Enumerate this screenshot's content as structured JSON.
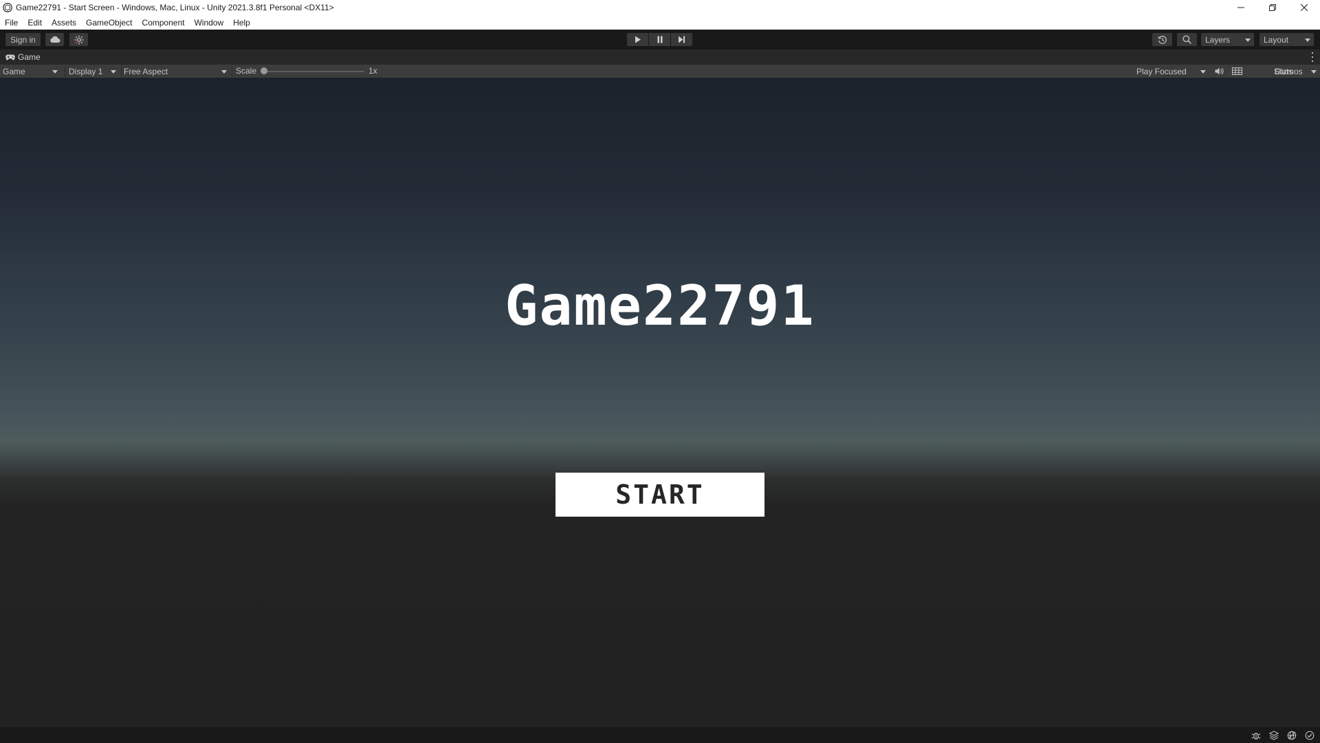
{
  "window": {
    "title": "Game22791 - Start Screen - Windows, Mac, Linux - Unity 2021.3.8f1 Personal <DX11>",
    "controls": [
      "minimize-icon",
      "restore-icon",
      "close-icon"
    ]
  },
  "menubar": {
    "items": [
      "File",
      "Edit",
      "Assets",
      "GameObject",
      "Component",
      "Window",
      "Help"
    ]
  },
  "toolbar": {
    "sign_in": "Sign in",
    "cloud_icon": "cloud-icon",
    "collab_icon": "services-icon",
    "play_icon": "play-icon",
    "pause_icon": "pause-icon",
    "step_icon": "step-icon",
    "history_icon": "history-icon",
    "search_icon": "search-icon",
    "layers": "Layers",
    "layout": "Layout"
  },
  "game_tab": {
    "label": "Game",
    "icon": "gamepad-icon"
  },
  "game_view": {
    "mode": "Game",
    "display": "Display 1",
    "aspect": "Free Aspect",
    "scale_label": "Scale",
    "scale_value": "1x",
    "play_mode": "Play Focused",
    "audio_icon": "speaker-icon",
    "stats_grid_icon": "grid-icon",
    "stats": "Stats",
    "gizmos": "Gizmos"
  },
  "game": {
    "title": "Game22791",
    "start_button": "START"
  },
  "statusbar": {
    "icons": [
      "debug-icon",
      "layers-status-icon",
      "network-icon",
      "check-icon"
    ]
  },
  "colors": {
    "toolbar_bg": "#191919",
    "panel_bg": "#3c3c3c",
    "game_text": "#ffffff",
    "button_bg": "#ffffff",
    "button_text": "#262626"
  }
}
